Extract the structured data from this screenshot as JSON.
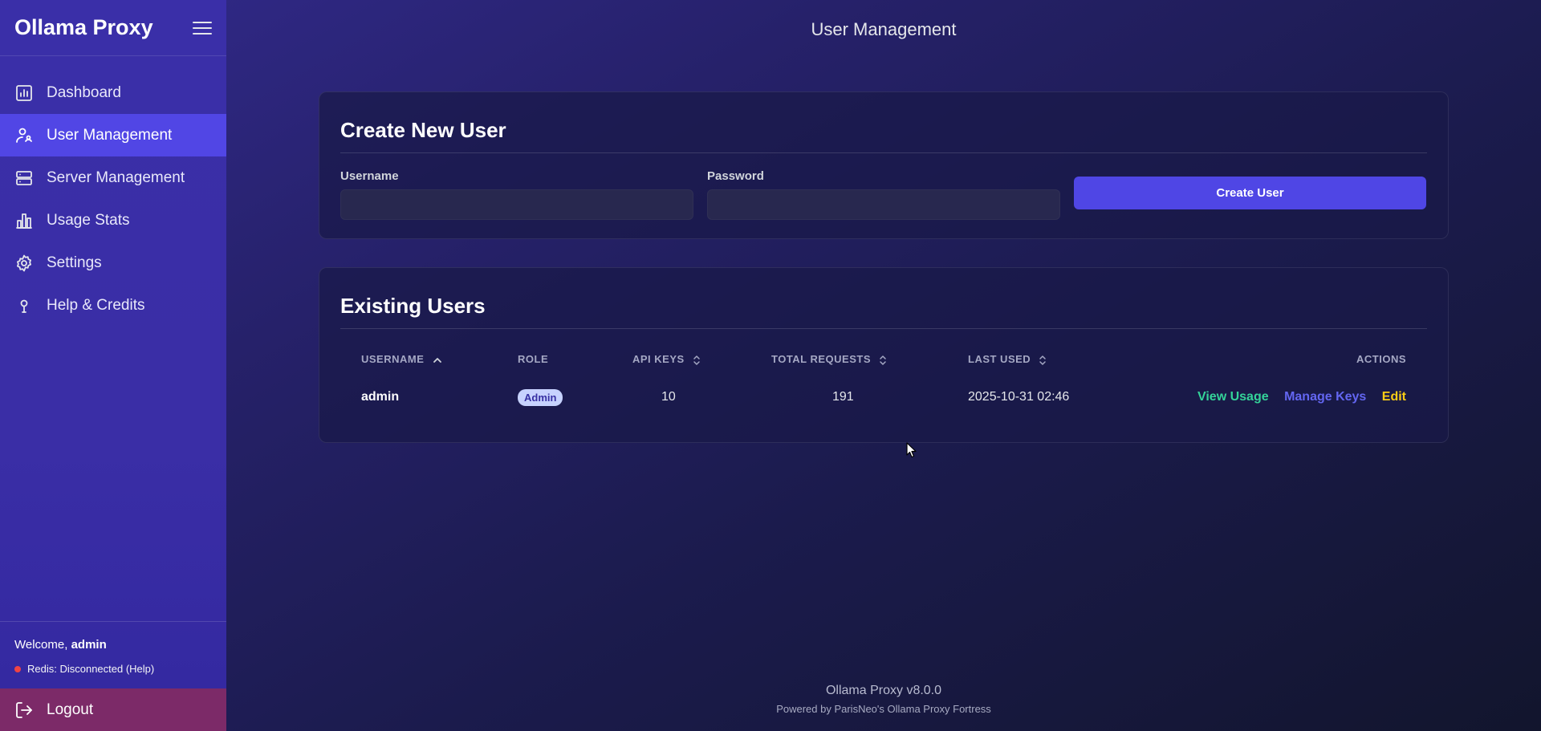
{
  "app": {
    "title": "Ollama Proxy"
  },
  "sidebar": {
    "items": [
      {
        "label": "Dashboard",
        "icon": "chart-icon"
      },
      {
        "label": "User Management",
        "icon": "users-icon",
        "active": true
      },
      {
        "label": "Server Management",
        "icon": "server-icon"
      },
      {
        "label": "Usage Stats",
        "icon": "bar-chart-icon"
      },
      {
        "label": "Settings",
        "icon": "gear-icon"
      },
      {
        "label": "Help & Credits",
        "icon": "help-icon"
      }
    ],
    "welcome_prefix": "Welcome,",
    "welcome_user": "admin",
    "redis_status": "Redis: Disconnected (Help)",
    "logout_label": "Logout"
  },
  "header": {
    "title": "User Management"
  },
  "create_card": {
    "title": "Create New User",
    "username_label": "Username",
    "username_value": "",
    "password_label": "Password",
    "password_value": "",
    "button_label": "Create User"
  },
  "users_card": {
    "title": "Existing Users",
    "columns": [
      "USERNAME",
      "ROLE",
      "API KEYS",
      "TOTAL REQUESTS",
      "LAST USED",
      "ACTIONS"
    ],
    "rows": [
      {
        "username": "admin",
        "role": "Admin",
        "api_keys": "10",
        "total_requests": "191",
        "last_used": "2025-10-31 02:46",
        "actions": [
          "View Usage",
          "Manage Keys",
          "Edit"
        ]
      }
    ]
  },
  "footer": {
    "version": "Ollama Proxy v8.0.0",
    "powered": "Powered by ParisNeo's Ollama Proxy Fortress"
  },
  "colors": {
    "accent": "#4f46e5",
    "sidebar": "#3a2ea6",
    "logout": "#7c2a68",
    "view_usage": "#34d399",
    "manage_keys": "#6366f1",
    "edit": "#facc15",
    "redis_dot": "#ef4444"
  }
}
